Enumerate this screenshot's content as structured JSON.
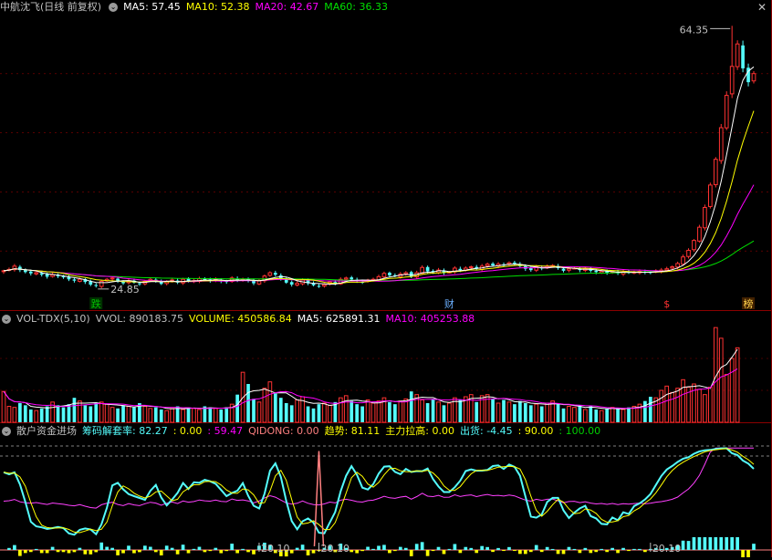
{
  "colors": {
    "up": "#ff3232",
    "down": "#54fcfc",
    "ma5": "#ffffff",
    "ma10": "#ffff00",
    "ma20": "#ff00ff",
    "ma60": "#00e000",
    "grid": "#8b0000",
    "zero": "#ff8080",
    "cost": "#ff40ff",
    "bull": "#ffff00",
    "bear": "#00d000"
  },
  "top_panel": {
    "title": "中航沈飞(日线 前复权)",
    "ma5": "MA5: 57.45",
    "ma10": "MA10: 52.38",
    "ma20": "MA20: 42.67",
    "ma60": "MA60: 36.33",
    "high_label": "64.35",
    "low_label": "24.85",
    "markers": [
      {
        "text": "跌",
        "index": 17,
        "color": "#00c000",
        "bg": "#003000"
      },
      {
        "text": "财",
        "index": 82,
        "color": "#6bb0ff",
        "bg": "#000"
      },
      {
        "text": "$",
        "index": 122,
        "color": "#ff3232",
        "bg": "#000"
      },
      {
        "text": "榜",
        "index": 137,
        "color": "#ffd24d",
        "bg": "#402000"
      }
    ]
  },
  "vol_panel": {
    "title": "VOL-TDX(5,10)",
    "vvol": "VVOL: 890183.75",
    "volume": "VOLUME: 450586.84",
    "ma5": "MA5: 625891.31",
    "ma10": "MA10: 405253.88"
  },
  "ind_panel": {
    "title": "散户资金进场",
    "t1": "筹码解套率: 82.27",
    "t2": ": 0.00",
    "t3": ": 59.47",
    "t4": "QIDONG: 0.00",
    "t5": "趋势: 81.11",
    "t6": "主力拉高: 0.00",
    "t7": "出货: -4.45",
    "t8": ": 90.00",
    "t9": ": 100.00",
    "labels": [
      {
        "text": "20.10",
        "index": 47
      },
      {
        "text": "20.10",
        "index": 58
      },
      {
        "text": "20.10",
        "index": 119
      }
    ]
  },
  "chart_data": [
    {
      "type": "candlestick",
      "title": "中航沈飞(日线 前复权)",
      "series_closes": [
        27.2,
        27.4,
        27.9,
        27.3,
        27.0,
        26.8,
        26.9,
        26.6,
        26.3,
        26.6,
        26.4,
        26.2,
        25.9,
        25.7,
        25.9,
        25.5,
        25.1,
        24.9,
        25.6,
        25.9,
        26.1,
        25.6,
        25.3,
        25.7,
        25.4,
        25.2,
        25.6,
        25.9,
        25.7,
        25.2,
        25.6,
        25.8,
        25.4,
        25.9,
        25.6,
        25.7,
        26.0,
        25.8,
        25.7,
        25.9,
        25.6,
        25.5,
        26.1,
        25.8,
        25.9,
        25.7,
        25.3,
        25.7,
        26.4,
        26.9,
        26.6,
        26.0,
        25.4,
        25.1,
        25.3,
        25.8,
        25.3,
        25.0,
        24.9,
        25.1,
        25.5,
        25.3,
        25.9,
        26.1,
        25.9,
        25.6,
        25.5,
        25.8,
        25.9,
        26.3,
        26.8,
        26.5,
        26.4,
        26.7,
        26.9,
        26.3,
        26.9,
        27.7,
        27.1,
        27.0,
        27.3,
        26.9,
        27.0,
        27.6,
        27.3,
        27.6,
        27.8,
        27.5,
        27.9,
        28.2,
        28.0,
        28.2,
        28.1,
        28.4,
        28.3,
        27.9,
        27.5,
        27.3,
        27.8,
        27.6,
        27.9,
        28.0,
        27.6,
        27.2,
        27.5,
        27.6,
        27.3,
        27.5,
        27.2,
        27.0,
        27.1,
        26.9,
        27.1,
        26.8,
        27.0,
        26.9,
        27.0,
        27.1,
        26.9,
        27.0,
        27.2,
        27.3,
        27.5,
        27.8,
        28.3,
        29.3,
        30.3,
        31.8,
        33.8,
        36.8,
        40.2,
        44.1,
        48.9,
        53.8,
        58.2,
        61.6,
        57.9,
        55.8,
        57.1
      ],
      "high": 64.35,
      "low": 24.85,
      "ylim": [
        24.0,
        65.5
      ],
      "ma_labels": [
        "MA5: 57.45",
        "MA10: 52.38",
        "MA20: 42.67",
        "MA60: 36.33"
      ]
    },
    {
      "type": "bar",
      "title": "VOL-TDX(5,10)",
      "values": [
        290000,
        150000,
        140000,
        180000,
        160000,
        120000,
        110000,
        130000,
        150000,
        190000,
        160000,
        140000,
        170000,
        230000,
        200000,
        160000,
        150000,
        180000,
        190000,
        170000,
        140000,
        130000,
        160000,
        150000,
        140000,
        180000,
        150000,
        130000,
        140000,
        120000,
        110000,
        130000,
        150000,
        120000,
        140000,
        130000,
        120000,
        150000,
        140000,
        130000,
        120000,
        140000,
        170000,
        260000,
        470000,
        360000,
        220000,
        190000,
        320000,
        380000,
        270000,
        230000,
        180000,
        160000,
        210000,
        240000,
        150000,
        130000,
        170000,
        180000,
        160000,
        190000,
        230000,
        250000,
        200000,
        170000,
        150000,
        210000,
        180000,
        200000,
        230000,
        190000,
        170000,
        200000,
        220000,
        290000,
        260000,
        210000,
        180000,
        220000,
        190000,
        160000,
        180000,
        230000,
        210000,
        240000,
        260000,
        190000,
        250000,
        260000,
        220000,
        180000,
        210000,
        190000,
        170000,
        200000,
        180000,
        160000,
        170000,
        150000,
        180000,
        200000,
        170000,
        130000,
        150000,
        140000,
        160000,
        120000,
        150000,
        120000,
        110000,
        130000,
        140000,
        130000,
        120000,
        140000,
        150000,
        170000,
        200000,
        240000,
        230000,
        300000,
        340000,
        280000,
        320000,
        400000,
        330000,
        360000,
        310000,
        260000,
        330000,
        890000,
        790000,
        450000,
        600000,
        700000
      ]
    },
    {
      "type": "line",
      "title": "散户资金进场",
      "ylim": [
        0,
        100
      ]
    }
  ]
}
